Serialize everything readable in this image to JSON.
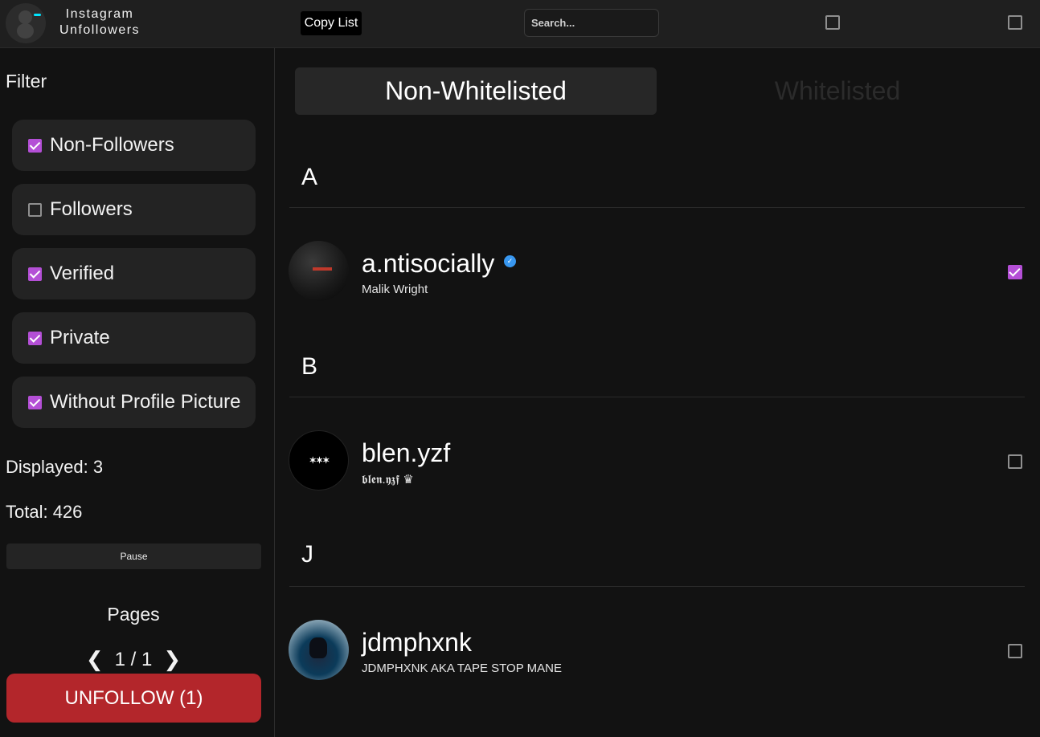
{
  "header": {
    "title_line1": "Instagram",
    "title_line2": "Unfollowers",
    "copy_label": "Copy List",
    "search_placeholder": "Search...",
    "checkbox1_checked": false,
    "checkbox2_checked": false
  },
  "sidebar": {
    "filter_title": "Filter",
    "filters": [
      {
        "label": "Non-Followers",
        "checked": true
      },
      {
        "label": "Followers",
        "checked": false
      },
      {
        "label": "Verified",
        "checked": true
      },
      {
        "label": "Private",
        "checked": true
      },
      {
        "label": "Without Profile Picture",
        "checked": true
      }
    ],
    "displayed": "Displayed: 3",
    "total": "Total: 426",
    "pause_label": "Pause",
    "pages_title": "Pages",
    "prev": "❮",
    "page_indicator": "1 / 1",
    "next": "❯",
    "unfollow_label": "UNFOLLOW (1)"
  },
  "main": {
    "tabs": [
      {
        "label": "Non-Whitelisted",
        "active": true
      },
      {
        "label": "Whitelisted",
        "active": false
      }
    ],
    "groups": [
      {
        "letter": "A",
        "users": [
          {
            "username": "a.ntisocially",
            "full_name": "Malik Wright",
            "verified": true,
            "checked": true
          }
        ]
      },
      {
        "letter": "B",
        "users": [
          {
            "username": "blen.yzf",
            "full_name": "𝖇𝖑𝖊𝖓.𝖞𝖟𝖋 ♛",
            "verified": false,
            "checked": false
          }
        ]
      },
      {
        "letter": "J",
        "users": [
          {
            "username": "jdmphxnk",
            "full_name": "JDMPHXNK AKA TAPE STOP MANE",
            "verified": false,
            "checked": false
          }
        ]
      }
    ],
    "verified_glyph": "✓"
  },
  "colors": {
    "accent": "#b44fd6",
    "unfollow": "#b3262b",
    "verified": "#3897f0",
    "logo_dash": "#00e5ff"
  }
}
